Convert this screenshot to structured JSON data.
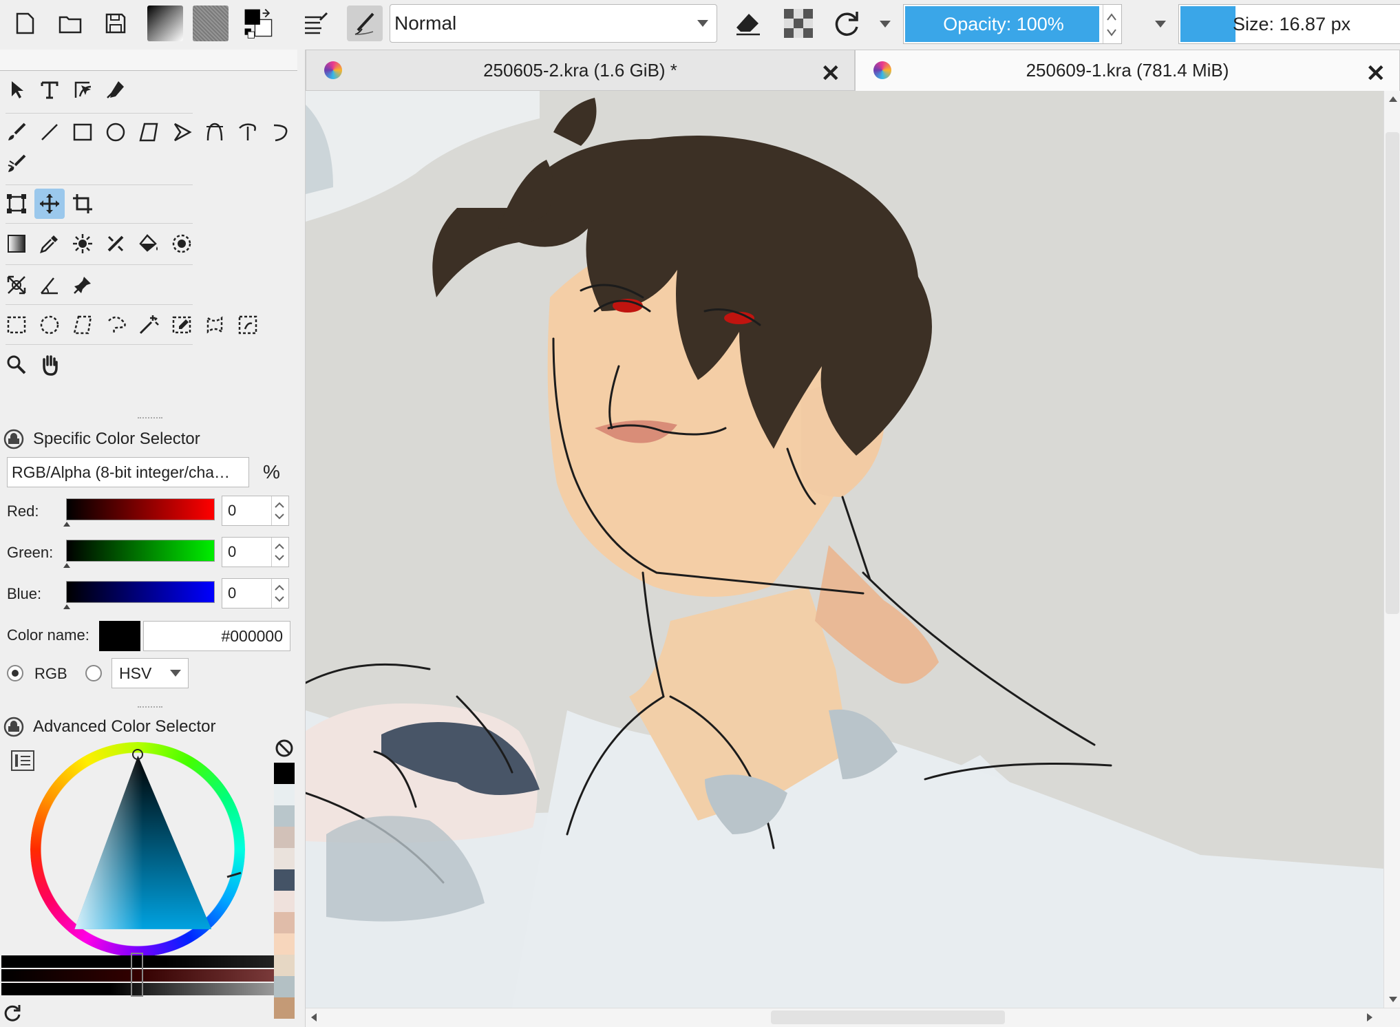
{
  "toolbar": {
    "blend_mode": "Normal",
    "opacity_label": "Opacity: 100%",
    "opacity_value": 1.0,
    "size_label": "Size: 16.87 px",
    "buttons": [
      "new-document-icon",
      "open-document-icon",
      "save-icon",
      "gradient-preset-icon",
      "pattern-preset-icon",
      "fg-bg-color-icon",
      "brush-settings-icon",
      "brush-preset-icon",
      "eraser-icon",
      "preserve-alpha-icon",
      "reload-preset-icon",
      "more-dropdown-icon"
    ]
  },
  "tabs": [
    {
      "label": "250605-2.kra (1.6 GiB) *",
      "active": false
    },
    {
      "label": "250609-1.kra (781.4 MiB)",
      "active": true
    }
  ],
  "tools": [
    [
      "select-shapes-icon",
      "text-tool-icon",
      "edit-shapes-icon",
      "calligraphy-icon"
    ],
    [
      "freehand-brush-icon",
      "line-tool-icon",
      "rectangle-tool-icon",
      "ellipse-tool-icon",
      "polygon-tool-icon",
      "polyline-tool-icon",
      "bezier-tool-icon",
      "freehand-path-icon",
      "dynamic-brush-icon"
    ],
    [
      "multibrush-icon"
    ],
    [
      "transform-tool-icon",
      "move-tool-icon",
      "crop-tool-icon"
    ],
    [
      "gradient-tool-icon",
      "color-picker-icon",
      "smart-patch-icon",
      "assistant-tool-icon",
      "fill-tool-icon",
      "enclose-fill-icon"
    ],
    [
      "perspective-grid-icon",
      "measure-tool-icon",
      "reference-pin-icon"
    ],
    [
      "rect-select-icon",
      "ellipse-select-icon",
      "polygon-select-icon",
      "freehand-select-icon",
      "magic-wand-icon",
      "similar-color-select-icon",
      "bezier-select-icon",
      "magnetic-select-icon"
    ],
    [
      "zoom-tool-icon",
      "pan-tool-icon"
    ]
  ],
  "specific_color": {
    "title": "Specific Color Selector",
    "color_space": "RGB/Alpha (8-bit integer/cha…",
    "percent_symbol": "%",
    "red_label": "Red:",
    "green_label": "Green:",
    "blue_label": "Blue:",
    "red": "0",
    "green": "0",
    "blue": "0",
    "color_name_label": "Color name:",
    "color_hex": "#000000",
    "rgb_label": "RGB",
    "hsv_label": "HSV"
  },
  "advanced_color": {
    "title": "Advanced Color Selector",
    "palette": [
      "#000000",
      "#e8eef0",
      "#b9c6cb",
      "#d2c1b8",
      "#eae2dc",
      "#445366",
      "#efe1dc",
      "#e0bca9",
      "#f7d6bc",
      "#e6d7c4",
      "#b3c0c4",
      "#c49a76"
    ]
  },
  "colors": {
    "accent": "#3aa6e8",
    "panel_bg": "#efefef",
    "canvas_bg": "#d9d9d5"
  }
}
